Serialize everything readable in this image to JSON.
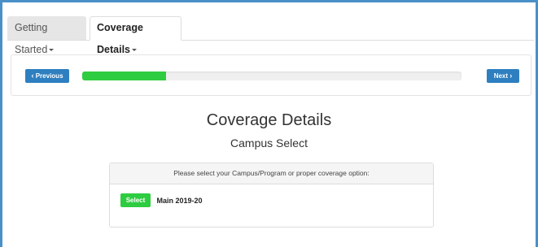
{
  "tabs": [
    {
      "label": "Getting Started",
      "active": false
    },
    {
      "label": "Coverage Details",
      "active": true
    }
  ],
  "wizard": {
    "previous_label": "Previous",
    "next_label": "Next",
    "progress_fraction": 0.22
  },
  "page": {
    "title": "Coverage Details",
    "subtitle": "Campus Select"
  },
  "card": {
    "header": "Please select your Campus/Program or proper coverage option:",
    "options": [
      {
        "button_label": "Select",
        "label": "Main 2019-20"
      }
    ]
  },
  "colors": {
    "frame": "#4a90c8",
    "nav_button": "#2e7fc0",
    "success": "#2ecc40"
  },
  "icons": {
    "previous": "chevron-left-icon",
    "next": "chevron-right-icon",
    "tab_dropdown": "caret-down-icon"
  }
}
